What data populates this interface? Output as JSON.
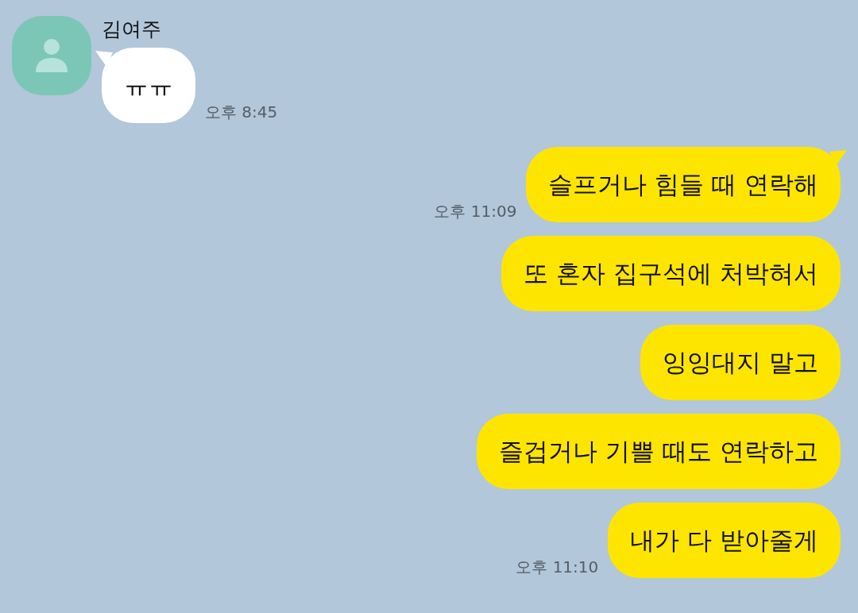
{
  "messages": [
    {
      "kind": "incoming",
      "name": "김여주",
      "text": "ㅠㅠ",
      "time": "오후 8:45",
      "tail": true
    },
    {
      "kind": "outgoing",
      "text": "슬프거나 힘들 때 연락해",
      "time": "오후 11:09",
      "tail": true
    },
    {
      "kind": "outgoing",
      "text": "또 혼자 집구석에 처박혀서",
      "tail": false
    },
    {
      "kind": "outgoing",
      "text": "잉잉대지 말고",
      "tail": false
    },
    {
      "kind": "outgoing",
      "text": "즐겁거나 기쁠 때도 연락하고",
      "tail": false
    },
    {
      "kind": "outgoing",
      "text": "내가 다 받아줄게",
      "time": "오후 11:10",
      "tail": false
    }
  ]
}
